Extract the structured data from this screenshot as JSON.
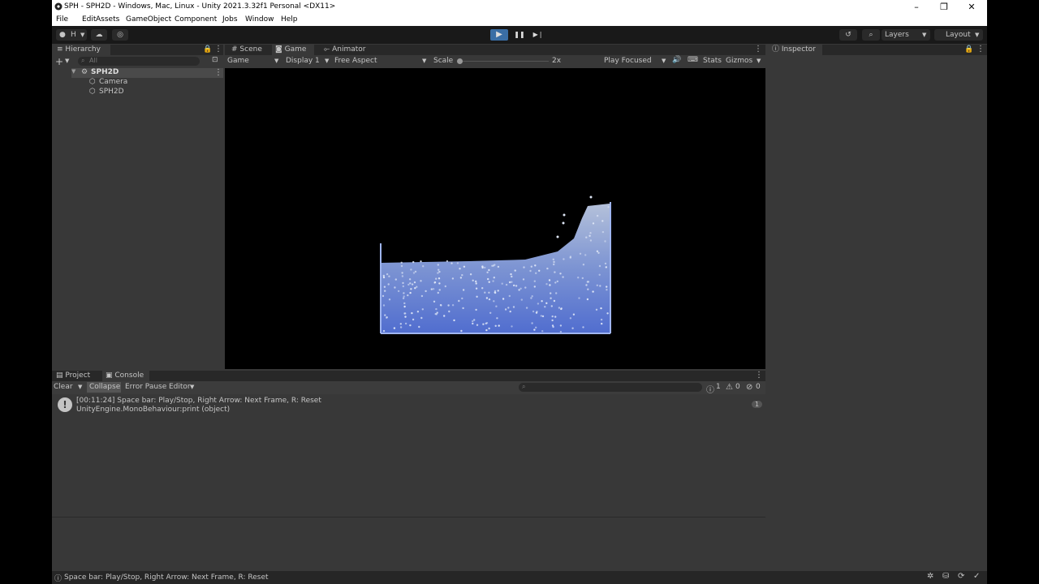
{
  "window": {
    "title": "SPH - SPH2D - Windows, Mac, Linux - Unity 2021.3.32f1 Personal <DX11>",
    "controls": {
      "minimize": "–",
      "maximize": "❐",
      "close": "✕"
    }
  },
  "menu": [
    "File",
    "Edit",
    "Assets",
    "GameObject",
    "Component",
    "Jobs",
    "Window",
    "Help"
  ],
  "toolbar": {
    "account_label": "H",
    "play_icon": "▶",
    "pause_icon": "❚❚",
    "step_icon": "▶❘",
    "layers_label": "Layers",
    "layout_label": "Layout"
  },
  "hierarchy": {
    "tab_label": "Hierarchy",
    "search_placeholder": "All",
    "scene_name": "SPH2D",
    "items": [
      "Camera",
      "SPH2D"
    ]
  },
  "game": {
    "tabs": [
      "Scene",
      "Game",
      "Animator"
    ],
    "display_mode": "Game",
    "display": "Display 1",
    "aspect": "Free Aspect",
    "scale_label": "Scale",
    "scale_value": "2x",
    "play_mode": "Play Focused",
    "stats_label": "Stats",
    "gizmos_label": "Gizmos",
    "fluid_colors": {
      "deep": "#5a7ae6",
      "mid": "#8aa4ea",
      "light": "#c8d6f2"
    }
  },
  "inspector": {
    "tab_label": "Inspector"
  },
  "console": {
    "tabs": [
      "Project",
      "Console"
    ],
    "clear_label": "Clear",
    "collapse_label": "Collapse",
    "error_pause_label": "Error Pause",
    "editor_label": "Editor",
    "counts": {
      "logs": "1",
      "warnings": "0",
      "errors": "0"
    },
    "entry": {
      "line1": "[00:11:24] Space bar: Play/Stop, Right Arrow: Next Frame, R: Reset",
      "line2": "UnityEngine.MonoBehaviour:print (object)",
      "count": "1"
    }
  },
  "status": {
    "message": "Space bar: Play/Stop, Right Arrow: Next Frame, R: Reset"
  }
}
